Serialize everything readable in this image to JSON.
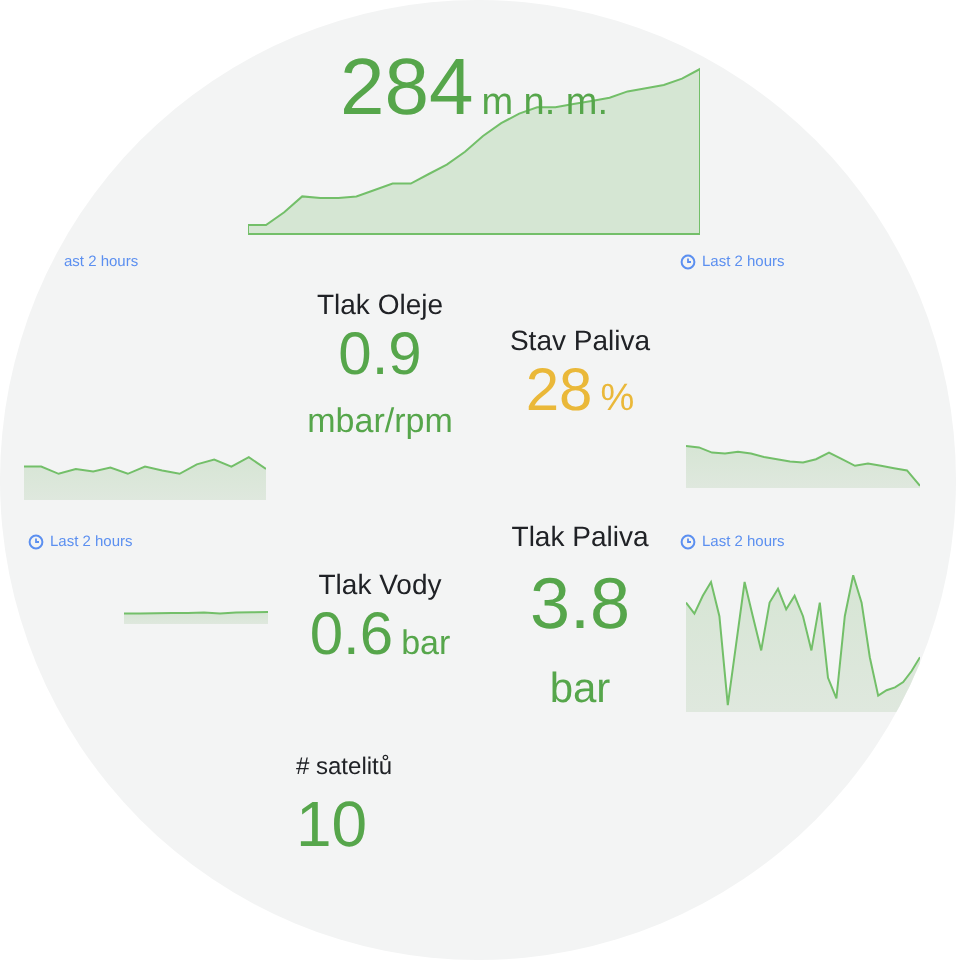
{
  "altitude": {
    "value": "284",
    "unit": "m n. m.",
    "color": "#56a64b"
  },
  "time_labels": [
    {
      "text": "ast 2 hours",
      "icon": false
    },
    {
      "text": "Last 2 hours",
      "icon": true
    },
    {
      "text": "Last 2 hours",
      "icon": true
    },
    {
      "text": "Last 2 hours",
      "icon": true
    }
  ],
  "stats": [
    {
      "title": "Tlak Oleje",
      "value": "0.9",
      "unit": "mbar/rpm",
      "kind": "stacked",
      "color": "#56a64b"
    },
    {
      "title": "Stav Paliva",
      "value": "28",
      "unit": "%",
      "kind": "inline",
      "color": "#eab839"
    },
    {
      "title": "Tlak Vody",
      "value": "0.6",
      "unit": "bar",
      "kind": "inline",
      "color": "#56a64b"
    },
    {
      "title": "Tlak Paliva",
      "value": "3.8",
      "unit": "bar",
      "kind": "stacked",
      "color": "#56a64b"
    },
    {
      "title": "# satelitů",
      "value": "10",
      "kind": "plain",
      "color": "#56a64b"
    }
  ]
}
